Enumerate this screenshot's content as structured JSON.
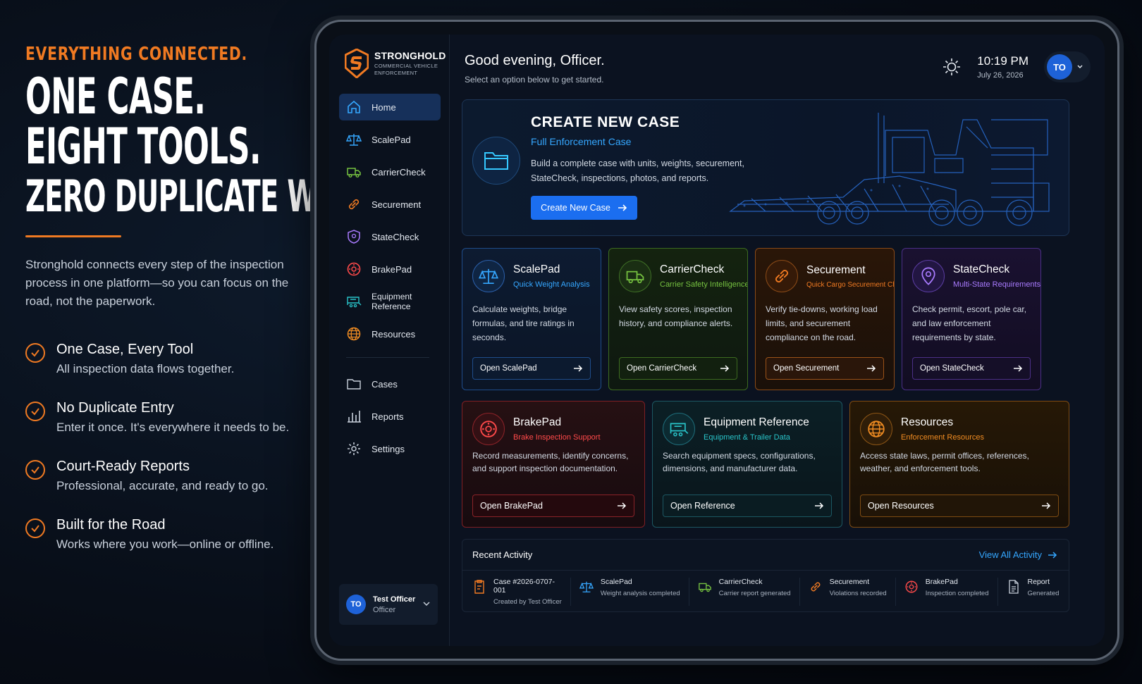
{
  "promo": {
    "eyebrow": "EVERYTHING CONNECTED.",
    "headline_1": "ONE CASE.",
    "headline_2": "EIGHT TOOLS.",
    "headline_3": "ZERO DUPLICATE WORK.",
    "description": "Stronghold connects every step of the inspection process in one platform—so you can focus on the road, not the paperwork.",
    "features": [
      {
        "title": "One Case, Every Tool",
        "text": "All inspection data flows together."
      },
      {
        "title": "No Duplicate Entry",
        "text": "Enter it once. It's everywhere it needs to be."
      },
      {
        "title": "Court-Ready Reports",
        "text": "Professional, accurate, and ready to go."
      },
      {
        "title": "Built for the Road",
        "text": "Works where you work—online or offline."
      }
    ]
  },
  "app": {
    "brand": "STRONGHOLD",
    "brand_sub_1": "COMMERCIAL VEHICLE",
    "brand_sub_2": "ENFORCEMENT",
    "nav": [
      {
        "label": "Home",
        "icon": "home-icon"
      },
      {
        "label": "ScalePad",
        "icon": "scale-icon"
      },
      {
        "label": "CarrierCheck",
        "icon": "truck-icon"
      },
      {
        "label": "Securement",
        "icon": "link-icon"
      },
      {
        "label": "StateCheck",
        "icon": "shield-icon"
      },
      {
        "label": "BrakePad",
        "icon": "brake-icon"
      },
      {
        "label": "Equipment Reference",
        "icon": "trailer-icon"
      },
      {
        "label": "Resources",
        "icon": "globe-icon"
      }
    ],
    "nav_secondary": [
      {
        "label": "Cases",
        "icon": "folder-icon"
      },
      {
        "label": "Reports",
        "icon": "bar-chart-icon"
      },
      {
        "label": "Settings",
        "icon": "gear-icon"
      }
    ],
    "user": {
      "initials": "TO",
      "name": "Test Officer",
      "role": "Officer"
    }
  },
  "header": {
    "greeting": "Good evening, Officer.",
    "subtitle": "Select an option below to get started.",
    "time": "10:19 PM",
    "date": "July 26, 2026"
  },
  "hero": {
    "title": "CREATE NEW CASE",
    "subtitle": "Full Enforcement Case",
    "description": "Build a complete case with units, weights, securement, StateCheck, inspections, photos, and reports.",
    "button": "Create New Case"
  },
  "tools": [
    {
      "title": "ScalePad",
      "subtitle": "Quick Weight Analysis",
      "description": "Calculate weights, bridge formulas, and tire ratings in seconds.",
      "button": "Open ScalePad",
      "color": "#35a7ff"
    },
    {
      "title": "CarrierCheck",
      "subtitle": "Carrier Safety Intelligence",
      "description": "View safety scores, inspection history, and compliance alerts.",
      "button": "Open CarrierCheck",
      "color": "#76c240"
    },
    {
      "title": "Securement",
      "subtitle": "Quick Cargo Securement Check",
      "description": "Verify tie-downs, working load limits, and securement compliance on the road.",
      "button": "Open Securement",
      "color": "#f07a22"
    },
    {
      "title": "StateCheck",
      "subtitle": "Multi-State Requirements",
      "description": "Check permit, escort, pole car, and law enforcement requirements by state.",
      "button": "Open StateCheck",
      "color": "#a97bff"
    },
    {
      "title": "BrakePad",
      "subtitle": "Brake Inspection Support",
      "description": "Record measurements, identify concerns, and support inspection documentation.",
      "button": "Open BrakePad",
      "color": "#ff4a4a"
    },
    {
      "title": "Equipment Reference",
      "subtitle": "Equipment & Trailer Data",
      "description": "Search equipment specs, configurations, dimensions, and manufacturer data.",
      "button": "Open Reference",
      "color": "#29c4c9"
    },
    {
      "title": "Resources",
      "subtitle": "Enforcement Resources",
      "description": "Access state laws, permit offices, references, weather, and enforcement tools.",
      "button": "Open Resources",
      "color": "#f08c22"
    }
  ],
  "activity": {
    "title": "Recent Activity",
    "link": "View All Activity",
    "items": [
      {
        "name": "Case #2026-0707-001",
        "desc": "Created by Test Officer",
        "icon": "case-icon"
      },
      {
        "name": "ScalePad",
        "desc": "Weight analysis completed",
        "icon": "scale-icon"
      },
      {
        "name": "CarrierCheck",
        "desc": "Carrier report generated",
        "icon": "truck-icon"
      },
      {
        "name": "Securement",
        "desc": "Violations recorded",
        "icon": "link-icon"
      },
      {
        "name": "BrakePad",
        "desc": "Inspection completed",
        "icon": "brake-icon"
      },
      {
        "name": "Report",
        "desc": "Generated",
        "icon": "document-icon"
      }
    ]
  }
}
